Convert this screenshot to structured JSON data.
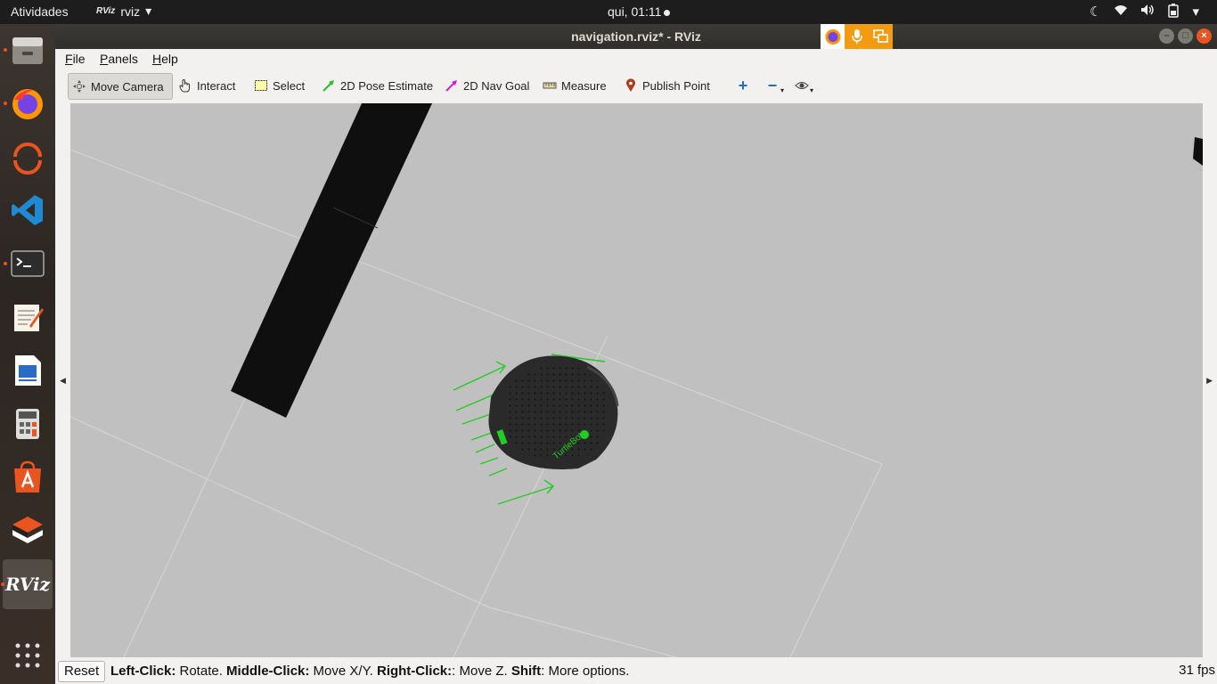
{
  "topbar": {
    "activities": "Atividades",
    "app_icon_text": "RViz",
    "app_name": "rviz",
    "clock": "qui, 01:11"
  },
  "window": {
    "title": "navigation.rviz* - RViz"
  },
  "menu": {
    "file": "File",
    "panels": "Panels",
    "help": "Help"
  },
  "toolbar": {
    "move_camera": "Move Camera",
    "interact": "Interact",
    "select": "Select",
    "pose_estimate": "2D Pose Estimate",
    "nav_goal": "2D Nav Goal",
    "measure": "Measure",
    "publish_point": "Publish Point",
    "active_tool": "Move Camera"
  },
  "viewport": {
    "robot_label": "TurtleBot"
  },
  "statusbar": {
    "reset": "Reset",
    "hint_left_key": "Left-Click:",
    "hint_left_val": " Rotate. ",
    "hint_middle_key": "Middle-Click:",
    "hint_middle_val": " Move X/Y. ",
    "hint_right_key": "Right-Click:",
    "hint_right_val": ": Move Z. ",
    "hint_shift_key": "Shift",
    "hint_shift_val": ": More options.",
    "fps": "31 fps"
  },
  "dock": {
    "apps": [
      "files-icon",
      "firefox-icon",
      "ubuntu-software-updater-icon",
      "vscode-icon",
      "terminal-icon",
      "text-editor-icon",
      "libreoffice-writer-icon",
      "calculator-icon",
      "ubuntu-software-icon",
      "multipass-icon",
      "rviz-icon",
      "app-grid-icon"
    ],
    "rviz_label": "RViz"
  },
  "colors": {
    "accent": "#e95420",
    "grid_bg": "#c0c0c0",
    "pose_arrows": "#22cc22",
    "robot_body": "#2a2a2a"
  }
}
